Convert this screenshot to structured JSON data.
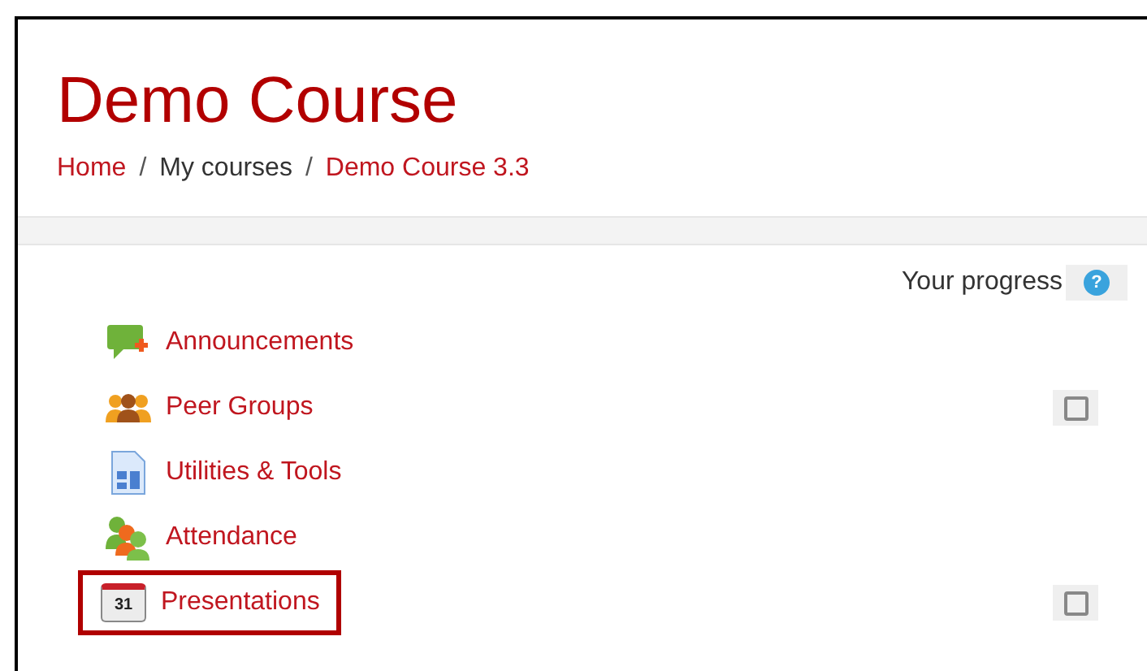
{
  "header": {
    "title": "Demo Course",
    "separator": "/",
    "breadcrumb": [
      {
        "label": "Home",
        "link": true
      },
      {
        "label": "My courses",
        "link": false
      },
      {
        "label": "Demo Course 3.3",
        "link": true
      }
    ]
  },
  "progress": {
    "label": "Your progress",
    "help_icon": "?"
  },
  "activities": [
    {
      "kind": "forum",
      "label": "Announcements",
      "highlighted": false
    },
    {
      "kind": "group",
      "label": "Peer Groups",
      "highlighted": false,
      "checkbox": {
        "checked": false
      }
    },
    {
      "kind": "page",
      "label": "Utilities & Tools",
      "highlighted": false
    },
    {
      "kind": "people",
      "label": "Attendance",
      "highlighted": false
    },
    {
      "kind": "calendar",
      "label": "Presentations",
      "highlighted": true,
      "checkbox": {
        "checked": false
      },
      "icon_text": "31"
    }
  ]
}
